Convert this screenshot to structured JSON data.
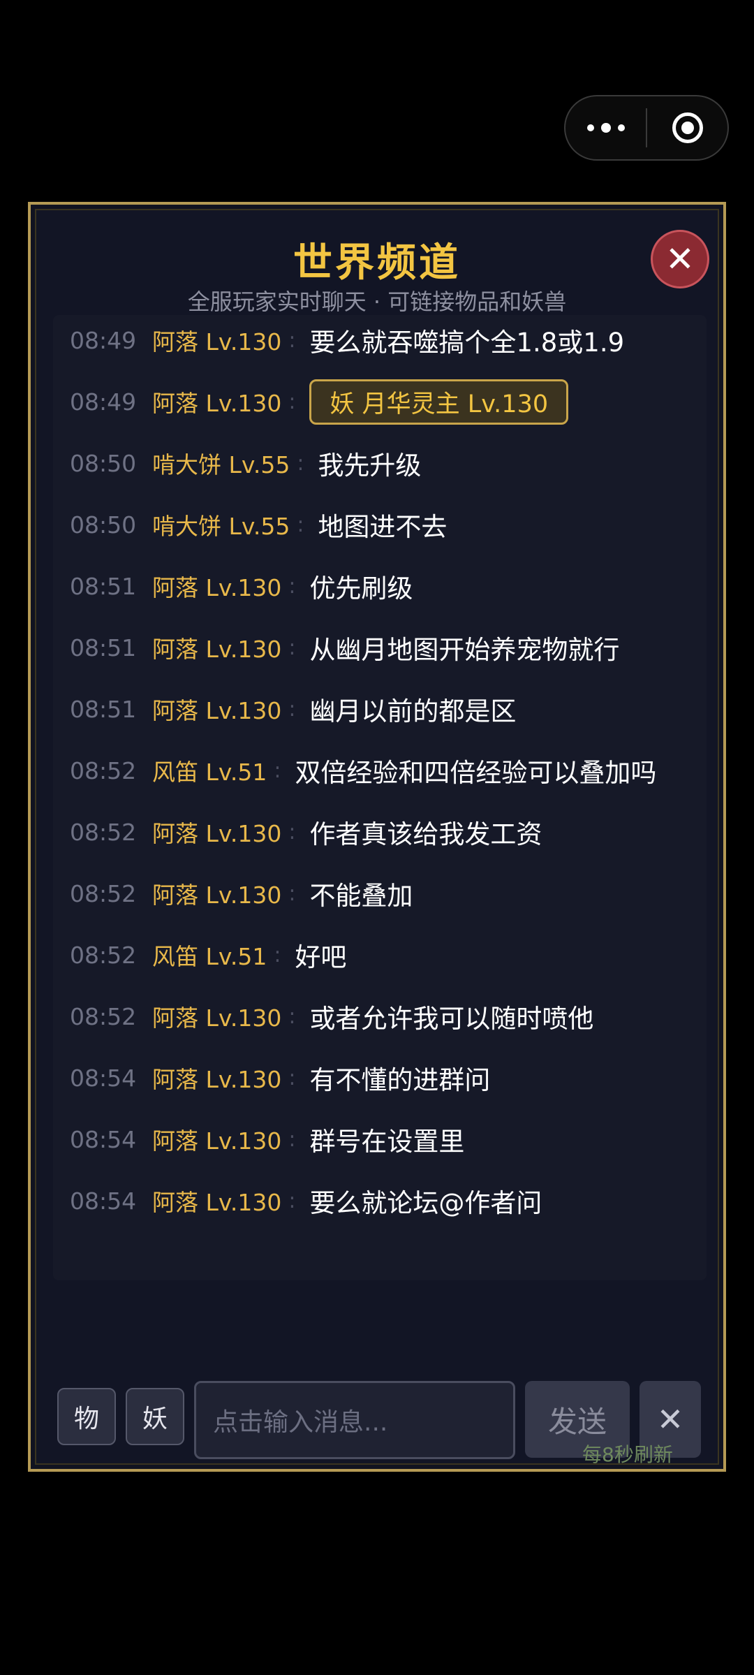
{
  "capsule": {
    "more_icon": "more-dots-icon",
    "target_icon": "target-icon"
  },
  "panel": {
    "title": "世界频道",
    "subtitle": "全服玩家实时聊天 · 可链接物品和妖兽",
    "close_icon": "close-icon",
    "close_symbol": "✕"
  },
  "messages": [
    {
      "time": "08:49",
      "name": "阿落 Lv.130",
      "text": "要么就吞噬搞个全1.8或1.9"
    },
    {
      "time": "08:49",
      "name": "阿落 Lv.130",
      "link": "妖 月华灵主 Lv.130"
    },
    {
      "time": "08:50",
      "name": "啃大饼 Lv.55",
      "text": "我先升级"
    },
    {
      "time": "08:50",
      "name": "啃大饼 Lv.55",
      "text": "地图进不去"
    },
    {
      "time": "08:51",
      "name": "阿落 Lv.130",
      "text": "优先刷级"
    },
    {
      "time": "08:51",
      "name": "阿落 Lv.130",
      "text": "从幽月地图开始养宠物就行"
    },
    {
      "time": "08:51",
      "name": "阿落 Lv.130",
      "text": "幽月以前的都是区"
    },
    {
      "time": "08:52",
      "name": "风笛 Lv.51",
      "text": "双倍经验和四倍经验可以叠加吗"
    },
    {
      "time": "08:52",
      "name": "阿落 Lv.130",
      "text": "作者真该给我发工资"
    },
    {
      "time": "08:52",
      "name": "阿落 Lv.130",
      "text": "不能叠加"
    },
    {
      "time": "08:52",
      "name": "风笛 Lv.51",
      "text": "好吧"
    },
    {
      "time": "08:52",
      "name": "阿落 Lv.130",
      "text": "或者允许我可以随时喷他"
    },
    {
      "time": "08:54",
      "name": "阿落 Lv.130",
      "text": "有不懂的进群问"
    },
    {
      "time": "08:54",
      "name": "阿落 Lv.130",
      "text": "群号在设置里"
    },
    {
      "time": "08:54",
      "name": "阿落 Lv.130",
      "text": "要么就论坛@作者问"
    }
  ],
  "colon": ":",
  "bottom": {
    "item_chip": "物",
    "pet_chip": "妖",
    "input_placeholder": "点击输入消息...",
    "send_label": "发送",
    "clear_symbol": "✕",
    "refresh_note": "每8秒刷新"
  },
  "colors": {
    "accent_gold": "#f3c542",
    "name_gold": "#e8b84a",
    "panel_border": "#b59a54",
    "close_red": "#8b2a32",
    "refresh_green": "#6f8a5e"
  }
}
